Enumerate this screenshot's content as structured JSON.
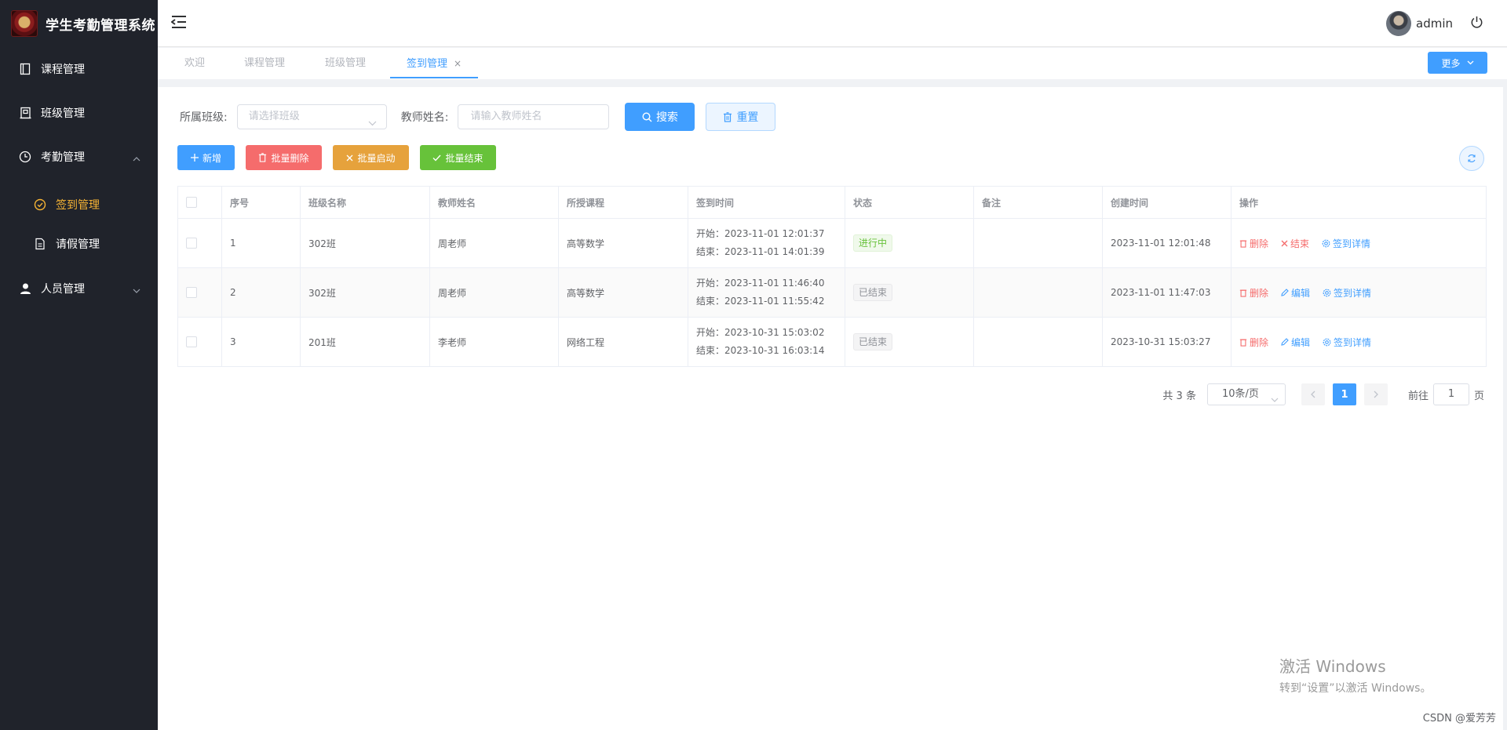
{
  "app": {
    "title": "学生考勤管理系统"
  },
  "sidebar": {
    "items": [
      {
        "label": "课程管理",
        "icon": "book-icon"
      },
      {
        "label": "班级管理",
        "icon": "building-icon"
      },
      {
        "label": "考勤管理",
        "icon": "clock-icon",
        "expanded": true
      },
      {
        "label": "人员管理",
        "icon": "user-icon",
        "expanded": false
      }
    ],
    "submenu": [
      {
        "label": "签到管理",
        "icon": "check-circle-icon",
        "active": true
      },
      {
        "label": "请假管理",
        "icon": "document-icon"
      }
    ]
  },
  "header": {
    "username": "admin"
  },
  "tabs": {
    "items": [
      {
        "label": "欢迎"
      },
      {
        "label": "课程管理"
      },
      {
        "label": "班级管理"
      },
      {
        "label": "签到管理",
        "active": true,
        "close": "×"
      }
    ],
    "more_label": "更多"
  },
  "filters": {
    "class_label": "所属班级:",
    "class_placeholder": "请选择班级",
    "teacher_label": "教师姓名:",
    "teacher_placeholder": "请输入教师姓名",
    "search_label": "搜索",
    "reset_label": "重置"
  },
  "toolbar": {
    "add_label": "新增",
    "batch_delete_label": "批量删除",
    "batch_start_label": "批量启动",
    "batch_end_label": "批量结束"
  },
  "table": {
    "headers": [
      "序号",
      "班级名称",
      "教师姓名",
      "所授课程",
      "签到时间",
      "状态",
      "备注",
      "创建时间",
      "操作"
    ],
    "rows": [
      {
        "no": "1",
        "class": "302班",
        "teacher": "周老师",
        "course": "高等数学",
        "start": "开始：2023-11-01 12:01:37",
        "end": "结束：2023-11-01 14:01:39",
        "status": "进行中",
        "remark": "",
        "created": "2023-11-01 12:01:48",
        "op_delete": "删除",
        "op_mid": "结束",
        "op_detail": "签到详情"
      },
      {
        "no": "2",
        "class": "302班",
        "teacher": "周老师",
        "course": "高等数学",
        "start": "开始：2023-11-01 11:46:40",
        "end": "结束：2023-11-01 11:55:42",
        "status": "已结束",
        "remark": "",
        "created": "2023-11-01 11:47:03",
        "op_delete": "删除",
        "op_mid": "编辑",
        "op_detail": "签到详情"
      },
      {
        "no": "3",
        "class": "201班",
        "teacher": "李老师",
        "course": "网络工程",
        "start": "开始：2023-10-31 15:03:02",
        "end": "结束：2023-10-31 16:03:14",
        "status": "已结束",
        "remark": "",
        "created": "2023-10-31 15:03:27",
        "op_delete": "删除",
        "op_mid": "编辑",
        "op_detail": "签到详情"
      }
    ]
  },
  "pagination": {
    "total_text": "共 3 条",
    "page_size": "10条/页",
    "current_page": "1",
    "goto_label": "前往",
    "goto_value": "1",
    "page_suffix": "页"
  },
  "watermark": {
    "line1": "激活 Windows",
    "line2": "转到“设置”以激活 Windows。"
  },
  "credit": "CSDN @爱芳芳",
  "colors": {
    "primary": "#409eff",
    "danger": "#f56c6c",
    "warning": "#e6a23c",
    "success": "#67c23a",
    "sidebar_bg": "#20232b",
    "sidebar_active": "#f5b334"
  }
}
